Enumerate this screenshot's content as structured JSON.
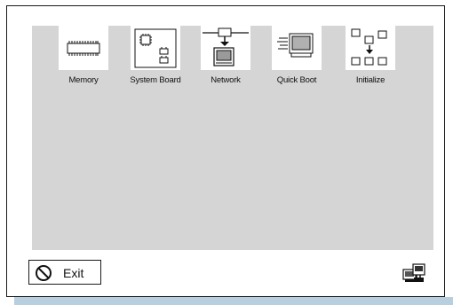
{
  "menu": {
    "items": [
      {
        "label": "Memory",
        "icon": "memory-icon"
      },
      {
        "label": "System Board",
        "icon": "system-board-icon"
      },
      {
        "label": "Network",
        "icon": "network-icon"
      },
      {
        "label": "Quick Boot",
        "icon": "quick-boot-icon"
      },
      {
        "label": "Initialize",
        "icon": "initialize-icon"
      }
    ]
  },
  "exit": {
    "label": "Exit",
    "icon": "no-symbol-icon"
  },
  "toolbar": {
    "help_icon": "computer-help-icon"
  },
  "colors": {
    "panel": "#d5d5d5",
    "tile": "#ffffff",
    "frame_border": "#1a1a1a",
    "bottom_band": "#b8cfe0"
  }
}
